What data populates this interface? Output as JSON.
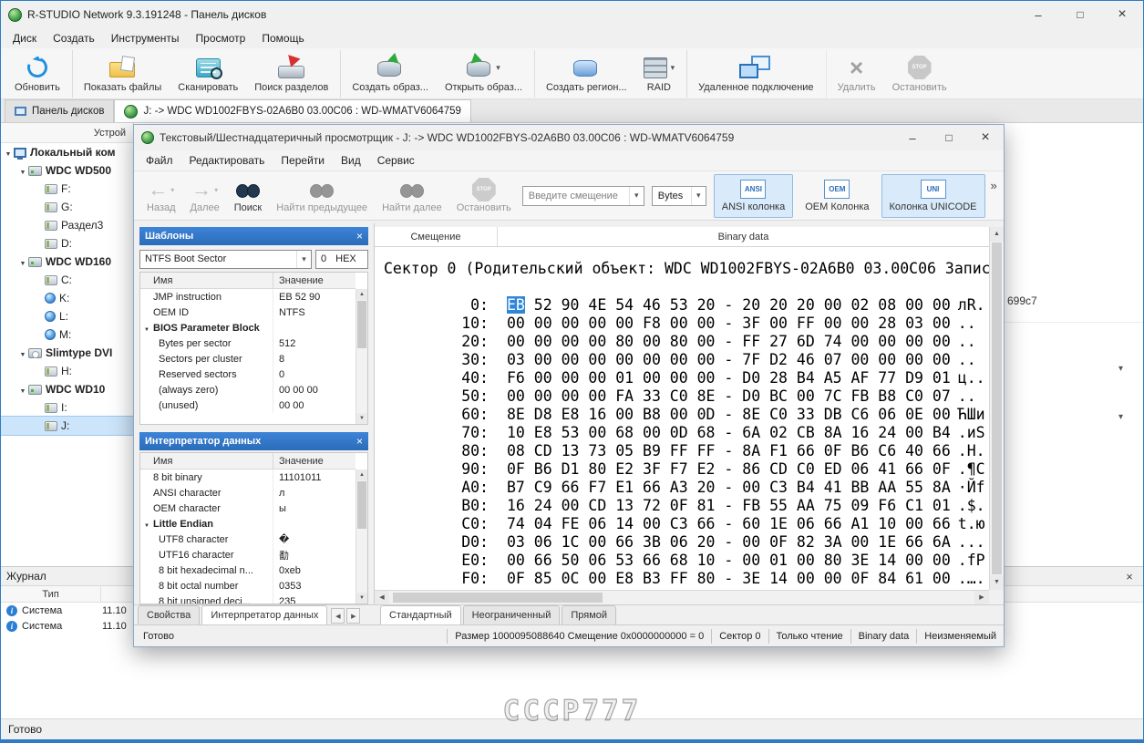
{
  "main": {
    "title": "R-STUDIO Network 9.3.191248 - Панель дисков",
    "menu": [
      {
        "label": "Диск"
      },
      {
        "label": "Создать"
      },
      {
        "label": "Инструменты"
      },
      {
        "label": "Просмотр"
      },
      {
        "label": "Помощь"
      }
    ],
    "toolbar": [
      {
        "label": "Обновить",
        "icon": "refresh-icon"
      },
      {
        "label": "Показать файлы",
        "icon": "show-files-icon",
        "sep_before": true
      },
      {
        "label": "Сканировать",
        "icon": "scan-icon"
      },
      {
        "label": "Поиск разделов",
        "icon": "search-partitions-icon"
      },
      {
        "label": "Создать образ...",
        "icon": "create-image-icon",
        "sep_before": true
      },
      {
        "label": "Открыть образ...",
        "icon": "open-image-icon",
        "dropdown": true
      },
      {
        "label": "Создать регион...",
        "icon": "create-region-icon",
        "sep_before": true
      },
      {
        "label": "RAID",
        "icon": "raid-icon",
        "dropdown": true
      },
      {
        "label": "Удаленное подключение",
        "icon": "remote-connect-icon",
        "sep_before": true
      },
      {
        "label": "Удалить",
        "icon": "delete-icon",
        "disabled": true,
        "sep_before": true
      },
      {
        "label": "Остановить",
        "icon": "stop-main-icon",
        "disabled": true
      }
    ],
    "tabs": [
      {
        "label": "Панель дисков",
        "icon": "disks-panel-icon"
      },
      {
        "label": "J: -> WDC WD1002FBYS-02A6B0 03.00C06 : WD-WMATV6064759",
        "icon": "rstudio-icon",
        "active": true
      }
    ],
    "tree": {
      "header": "Устрой",
      "items": [
        {
          "label": "Локальный ком",
          "icon": "computer-icon",
          "depth": 0,
          "expander_on": true,
          "bold": true
        },
        {
          "label": "WDC WD500",
          "icon": "hdd-icon",
          "depth": 1,
          "expander_on": true,
          "bold": true
        },
        {
          "label": "F:",
          "icon": "partition-icon",
          "depth": 2
        },
        {
          "label": "G:",
          "icon": "partition-icon",
          "depth": 2
        },
        {
          "label": "Раздел3",
          "icon": "partition-icon",
          "depth": 2
        },
        {
          "label": "D:",
          "icon": "partition-icon",
          "depth": 2
        },
        {
          "label": "WDC WD160",
          "icon": "hdd-icon",
          "depth": 1,
          "expander_on": true,
          "bold": true
        },
        {
          "label": "C:",
          "icon": "partition-icon",
          "depth": 2
        },
        {
          "label": "K:",
          "icon": "volume-icon",
          "depth": 2
        },
        {
          "label": "L:",
          "icon": "volume-icon",
          "depth": 2
        },
        {
          "label": "M:",
          "icon": "volume-icon",
          "depth": 2
        },
        {
          "label": "Slimtype DVI",
          "icon": "dvd-drive-icon",
          "depth": 1,
          "expander_on": true,
          "bold": true
        },
        {
          "label": "H:",
          "icon": "partition-icon",
          "depth": 2
        },
        {
          "label": "WDC WD10",
          "icon": "hdd-icon",
          "depth": 1,
          "expander_on": true,
          "bold": true
        },
        {
          "label": "I:",
          "icon": "partition-icon",
          "depth": 2
        },
        {
          "label": "J:",
          "icon": "partition-icon",
          "depth": 2,
          "selected": true
        }
      ]
    },
    "journal": {
      "title": "Журнал",
      "columns": [
        "Тип"
      ],
      "rows": [
        {
          "type": "Система",
          "icon": "info-icon",
          "time": "11.10"
        },
        {
          "type": "Система",
          "icon": "info-icon",
          "time": "11.10"
        }
      ]
    },
    "fragments": {
      "serial": "699c7"
    },
    "status": "Готово"
  },
  "viewer": {
    "title": "Текстовый/Шестнадцатеричный просмотрщик - J: -> WDC WD1002FBYS-02A6B0 03.00C06 : WD-WMATV6064759",
    "menu": [
      {
        "label": "Файл"
      },
      {
        "label": "Редактировать"
      },
      {
        "label": "Перейти"
      },
      {
        "label": "Вид"
      },
      {
        "label": "Сервис"
      }
    ],
    "toolbar": {
      "buttons": [
        {
          "label": "Назад",
          "icon": "back-arrow-icon",
          "disabled": true,
          "dropdown": true
        },
        {
          "label": "Далее",
          "icon": "forward-arrow-icon",
          "disabled": true,
          "dropdown": true
        },
        {
          "label": "Поиск",
          "icon": "binoculars-icon"
        },
        {
          "label": "Найти предыдущее",
          "icon": "find-prev-icon",
          "disabled": true
        },
        {
          "label": "Найти далее",
          "icon": "find-next-icon",
          "disabled": true
        },
        {
          "label": "Остановить",
          "icon": "stop-octagon-icon",
          "disabled": true
        }
      ],
      "offset_placeholder": "Введите смещение",
      "unit_value": "Bytes",
      "toggles": [
        {
          "label": "ANSI колонка",
          "icon_text": "ANSI",
          "active": true
        },
        {
          "label": "OEM Колонка",
          "icon_text": "OEM"
        },
        {
          "label": "Колонка UNICODE",
          "icon_text": "UNI",
          "active": true
        }
      ],
      "overflow": "»"
    },
    "templates": {
      "title": "Шаблоны",
      "combo": "NTFS Boot Sector",
      "offset_value": "0",
      "offset_unit": "HEX",
      "columns": {
        "name": "Имя",
        "value": "Значение"
      },
      "rows": [
        {
          "name": "JMP instruction",
          "value": "EB 52 90"
        },
        {
          "name": "OEM ID",
          "value": "NTFS"
        },
        {
          "name": "BIOS Parameter Block",
          "value": "",
          "group": true
        },
        {
          "name": "Bytes per sector",
          "value": "512",
          "child": true
        },
        {
          "name": "Sectors per cluster",
          "value": "8",
          "child": true
        },
        {
          "name": "Reserved sectors",
          "value": "0",
          "child": true
        },
        {
          "name": "(always zero)",
          "value": "00 00 00",
          "child": true
        },
        {
          "name": "(unused)",
          "value": "00 00",
          "child": true
        }
      ]
    },
    "interpreter": {
      "title": "Интерпретатор данных",
      "columns": {
        "name": "Имя",
        "value": "Значение"
      },
      "rows": [
        {
          "name": "8 bit binary",
          "value": "11101011"
        },
        {
          "name": "ANSI character",
          "value": "л"
        },
        {
          "name": "OEM character",
          "value": "ы"
        },
        {
          "name": "Little Endian",
          "value": "",
          "group": true
        },
        {
          "name": "UTF8 character",
          "value": "�",
          "child": true
        },
        {
          "name": "UTF16 character",
          "value": "勫",
          "child": true
        },
        {
          "name": "8 bit hexadecimal n...",
          "value": "0xeb",
          "child": true
        },
        {
          "name": "8 bit octal number",
          "value": "0353",
          "child": true
        },
        {
          "name": "8 bit unsigned deci...",
          "value": "235",
          "child": true
        }
      ]
    },
    "left_tabs": [
      {
        "label": "Свойства"
      },
      {
        "label": "Интерпретатор данных",
        "active": true
      }
    ],
    "hex": {
      "col_offset": "Смещение",
      "col_data": "Binary data",
      "sector_line": "Сектор 0 (Родительский объект: WDC WD1002FBYS-02A6B0 03.00C06 Запис",
      "rows": [
        {
          "o": "0:",
          "sel": "EB",
          "l": "52 90 4E 54 46 53 20",
          "r": "20 20 20 00 02 08 00 00",
          "a": "лR."
        },
        {
          "o": "10:",
          "l": "00 00 00 00 00 F8 00 00",
          "r": "3F 00 FF 00 00 28 03 00",
          "a": ".."
        },
        {
          "o": "20:",
          "l": "00 00 00 00 80 00 80 00",
          "r": "FF 27 6D 74 00 00 00 00",
          "a": ".."
        },
        {
          "o": "30:",
          "l": "03 00 00 00 00 00 00 00",
          "r": "7F D2 46 07 00 00 00 00",
          "a": ".."
        },
        {
          "o": "40:",
          "l": "F6 00 00 00 01 00 00 00",
          "r": "D0 28 B4 A5 AF 77 D9 01",
          "a": "ц.."
        },
        {
          "o": "50:",
          "l": "00 00 00 00 FA 33 C0 8E",
          "r": "D0 BC 00 7C FB B8 C0 07",
          "a": ".."
        },
        {
          "o": "60:",
          "l": "8E D8 E8 16 00 B8 00 0D",
          "r": "8E C0 33 DB C6 06 0E 00",
          "a": "ЋШи"
        },
        {
          "o": "70:",
          "l": "10 E8 53 00 68 00 0D 68",
          "r": "6A 02 CB 8A 16 24 00 B4",
          "a": ".иS"
        },
        {
          "o": "80:",
          "l": "08 CD 13 73 05 B9 FF FF",
          "r": "8A F1 66 0F B6 C6 40 66",
          "a": ".Н."
        },
        {
          "o": "90:",
          "l": "0F B6 D1 80 E2 3F F7 E2",
          "r": "86 CD C0 ED 06 41 66 0F",
          "a": ".¶С"
        },
        {
          "o": "A0:",
          "l": "B7 C9 66 F7 E1 66 A3 20",
          "r": "00 C3 B4 41 BB AA 55 8A",
          "a": "·Йf"
        },
        {
          "o": "B0:",
          "l": "16 24 00 CD 13 72 0F 81",
          "r": "FB 55 AA 75 09 F6 C1 01",
          "a": ".$."
        },
        {
          "o": "C0:",
          "l": "74 04 FE 06 14 00 C3 66",
          "r": "60 1E 06 66 A1 10 00 66",
          "a": "t.ю"
        },
        {
          "o": "D0:",
          "l": "03 06 1C 00 66 3B 06 20",
          "r": "00 0F 82 3A 00 1E 66 6A",
          "a": "..."
        },
        {
          "o": "E0:",
          "l": "00 66 50 06 53 66 68 10",
          "r": "00 01 00 80 3E 14 00 00",
          "a": ".fP"
        },
        {
          "o": "F0:",
          "l": "0F 85 0C 00 E8 B3 FF 80",
          "r": "3E 14 00 00 0F 84 61 00",
          "a": ".…."
        }
      ]
    },
    "bottom_tabs": [
      {
        "label": "Стандартный",
        "active": true
      },
      {
        "label": "Неограниченный"
      },
      {
        "label": "Прямой"
      }
    ],
    "status": {
      "left": "Готово",
      "segments": [
        "Размер 1000095088640 Смещение 0x0000000000 = 0",
        "Сектор 0",
        "Только чтение",
        "Binary data",
        "Неизменяемый"
      ]
    }
  },
  "watermark": "СССР777"
}
